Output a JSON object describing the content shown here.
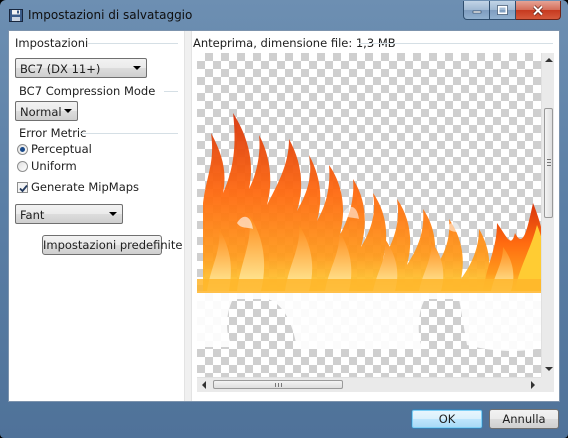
{
  "window": {
    "title": "Impostazioni di salvataggio"
  },
  "left_panel": {
    "section_label": "Impostazioni",
    "format_combo": "BC7 (DX 11+)",
    "compression_group_label": "BC7 Compression Mode",
    "compression_combo": "Normal",
    "error_metric_group_label": "Error Metric",
    "error_metric_options": [
      {
        "label": "Perceptual",
        "checked": true
      },
      {
        "label": "Uniform",
        "checked": false
      }
    ],
    "mipmaps_label": "Generate MipMaps",
    "mipmaps_checked": true,
    "filter_combo": "Fant",
    "defaults_button": "Impostazioni predefinite"
  },
  "preview": {
    "label": "Anteprima, dimensione file: 1,3 MB",
    "image": "fire-flames-on-transparent-background",
    "vertical_scroll": 0.0,
    "horizontal_scroll": 0.0
  },
  "footer": {
    "ok_label": "OK",
    "cancel_label": "Annulla"
  },
  "colors": {
    "accent": "#3c7fb1",
    "title_bar": "#5b7fa6",
    "close_button": "#c6391f",
    "flame_core": "#ffd23a",
    "flame_mid": "#ff7a12",
    "flame_edge": "#d8350c"
  }
}
